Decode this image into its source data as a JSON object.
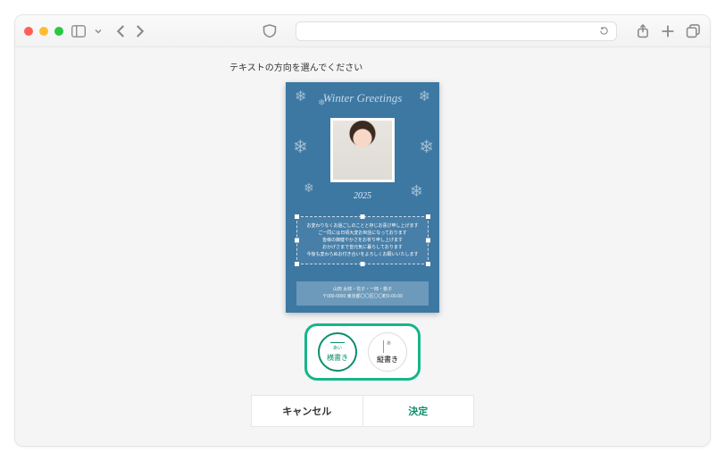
{
  "page": {
    "title": "テキストの方向を選んでください"
  },
  "postcard": {
    "title": "Winter Greetings",
    "year": "2025",
    "greeting": [
      "お変わりなくお過ごしのことと存じお喜び申し上げます",
      "ご一同には日頃大変お世話になっております",
      "皆様の御健やかさをお祈り申し上げます",
      "おかげさまで皆元気に暮らしております",
      "今後も変わらぬお付き合いをよろしくお願いいたします"
    ],
    "signature_line1": "山田 太郎・花子・一郎・桃子",
    "signature_line2": "〒000-0000 東京都〇〇区〇〇町0-00-00"
  },
  "direction": {
    "horizontal": {
      "mini": "あい",
      "label": "横書き"
    },
    "vertical": {
      "mini": "あ",
      "label": "縦書き"
    }
  },
  "footer": {
    "cancel": "キャンセル",
    "confirm": "決定"
  }
}
